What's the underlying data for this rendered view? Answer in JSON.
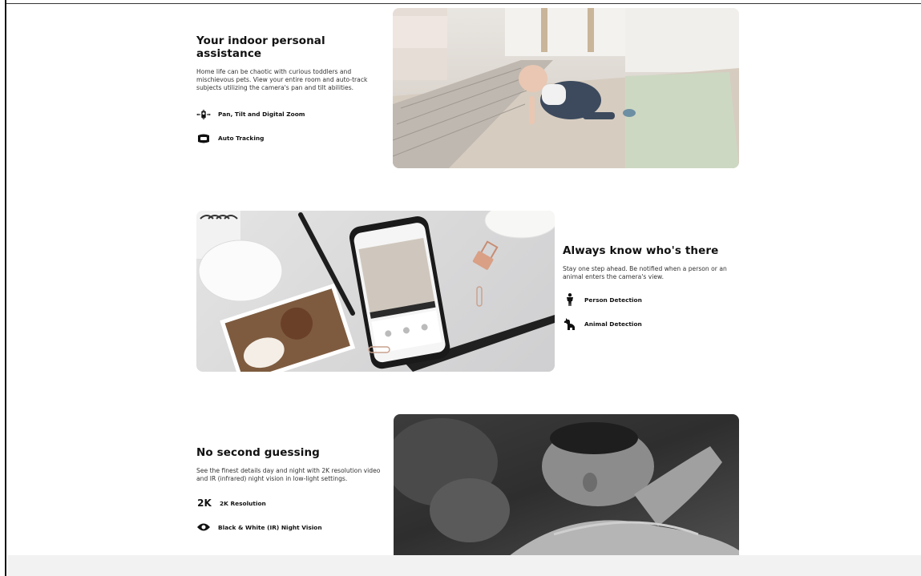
{
  "section1": {
    "title": "Your indoor personal assistance",
    "description": "Home life can be chaotic with curious toddlers and mischievous pets. View your entire room and auto-track subjects utilizing the camera's pan and tilt abilities.",
    "features": [
      {
        "label": "Pan, Tilt and Digital Zoom",
        "icon": "pan-tilt-zoom-icon"
      },
      {
        "label": "Auto Tracking",
        "icon": "auto-tracking-icon"
      }
    ]
  },
  "section2": {
    "title": "Always know who's there",
    "description": "Stay one step ahead. Be notified when a person or an animal enters the camera's view.",
    "features": [
      {
        "label": "Person Detection",
        "icon": "person-icon"
      },
      {
        "label": "Animal Detection",
        "icon": "animal-icon"
      }
    ]
  },
  "section3": {
    "title": "No second guessing",
    "description": "See the finest details day and night with 2K resolution video and IR (infrared) night vision in low-light settings.",
    "features": [
      {
        "label": "2K Resolution",
        "icon": "2k-badge-icon",
        "badge": "2K"
      },
      {
        "label": "Black & White (IR) Night Vision",
        "icon": "eye-icon"
      }
    ]
  },
  "colors": {
    "text": "#111111",
    "footer_band": "#f2f2f3",
    "night_photo": "#3a3a3a"
  }
}
